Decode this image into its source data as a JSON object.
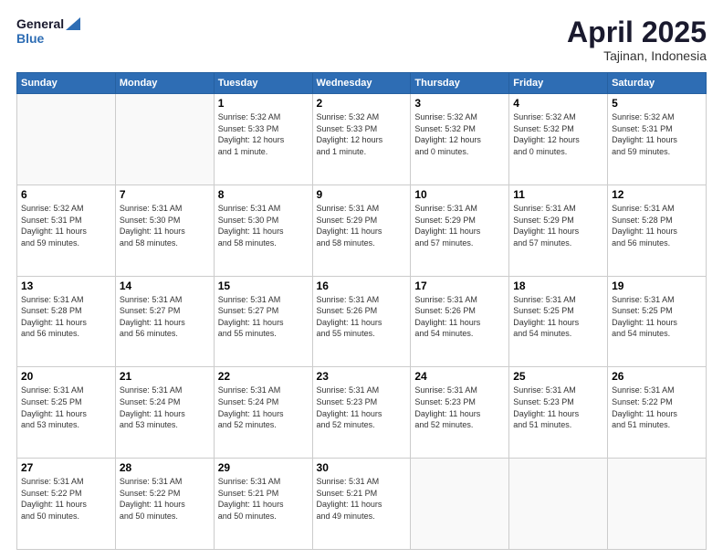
{
  "header": {
    "logo_line1": "General",
    "logo_line2": "Blue",
    "title": "April 2025",
    "location": "Tajinan, Indonesia"
  },
  "days_of_week": [
    "Sunday",
    "Monday",
    "Tuesday",
    "Wednesday",
    "Thursday",
    "Friday",
    "Saturday"
  ],
  "weeks": [
    [
      {
        "day": "",
        "info": ""
      },
      {
        "day": "",
        "info": ""
      },
      {
        "day": "1",
        "info": "Sunrise: 5:32 AM\nSunset: 5:33 PM\nDaylight: 12 hours\nand 1 minute."
      },
      {
        "day": "2",
        "info": "Sunrise: 5:32 AM\nSunset: 5:33 PM\nDaylight: 12 hours\nand 1 minute."
      },
      {
        "day": "3",
        "info": "Sunrise: 5:32 AM\nSunset: 5:32 PM\nDaylight: 12 hours\nand 0 minutes."
      },
      {
        "day": "4",
        "info": "Sunrise: 5:32 AM\nSunset: 5:32 PM\nDaylight: 12 hours\nand 0 minutes."
      },
      {
        "day": "5",
        "info": "Sunrise: 5:32 AM\nSunset: 5:31 PM\nDaylight: 11 hours\nand 59 minutes."
      }
    ],
    [
      {
        "day": "6",
        "info": "Sunrise: 5:32 AM\nSunset: 5:31 PM\nDaylight: 11 hours\nand 59 minutes."
      },
      {
        "day": "7",
        "info": "Sunrise: 5:31 AM\nSunset: 5:30 PM\nDaylight: 11 hours\nand 58 minutes."
      },
      {
        "day": "8",
        "info": "Sunrise: 5:31 AM\nSunset: 5:30 PM\nDaylight: 11 hours\nand 58 minutes."
      },
      {
        "day": "9",
        "info": "Sunrise: 5:31 AM\nSunset: 5:29 PM\nDaylight: 11 hours\nand 58 minutes."
      },
      {
        "day": "10",
        "info": "Sunrise: 5:31 AM\nSunset: 5:29 PM\nDaylight: 11 hours\nand 57 minutes."
      },
      {
        "day": "11",
        "info": "Sunrise: 5:31 AM\nSunset: 5:29 PM\nDaylight: 11 hours\nand 57 minutes."
      },
      {
        "day": "12",
        "info": "Sunrise: 5:31 AM\nSunset: 5:28 PM\nDaylight: 11 hours\nand 56 minutes."
      }
    ],
    [
      {
        "day": "13",
        "info": "Sunrise: 5:31 AM\nSunset: 5:28 PM\nDaylight: 11 hours\nand 56 minutes."
      },
      {
        "day": "14",
        "info": "Sunrise: 5:31 AM\nSunset: 5:27 PM\nDaylight: 11 hours\nand 56 minutes."
      },
      {
        "day": "15",
        "info": "Sunrise: 5:31 AM\nSunset: 5:27 PM\nDaylight: 11 hours\nand 55 minutes."
      },
      {
        "day": "16",
        "info": "Sunrise: 5:31 AM\nSunset: 5:26 PM\nDaylight: 11 hours\nand 55 minutes."
      },
      {
        "day": "17",
        "info": "Sunrise: 5:31 AM\nSunset: 5:26 PM\nDaylight: 11 hours\nand 54 minutes."
      },
      {
        "day": "18",
        "info": "Sunrise: 5:31 AM\nSunset: 5:25 PM\nDaylight: 11 hours\nand 54 minutes."
      },
      {
        "day": "19",
        "info": "Sunrise: 5:31 AM\nSunset: 5:25 PM\nDaylight: 11 hours\nand 54 minutes."
      }
    ],
    [
      {
        "day": "20",
        "info": "Sunrise: 5:31 AM\nSunset: 5:25 PM\nDaylight: 11 hours\nand 53 minutes."
      },
      {
        "day": "21",
        "info": "Sunrise: 5:31 AM\nSunset: 5:24 PM\nDaylight: 11 hours\nand 53 minutes."
      },
      {
        "day": "22",
        "info": "Sunrise: 5:31 AM\nSunset: 5:24 PM\nDaylight: 11 hours\nand 52 minutes."
      },
      {
        "day": "23",
        "info": "Sunrise: 5:31 AM\nSunset: 5:23 PM\nDaylight: 11 hours\nand 52 minutes."
      },
      {
        "day": "24",
        "info": "Sunrise: 5:31 AM\nSunset: 5:23 PM\nDaylight: 11 hours\nand 52 minutes."
      },
      {
        "day": "25",
        "info": "Sunrise: 5:31 AM\nSunset: 5:23 PM\nDaylight: 11 hours\nand 51 minutes."
      },
      {
        "day": "26",
        "info": "Sunrise: 5:31 AM\nSunset: 5:22 PM\nDaylight: 11 hours\nand 51 minutes."
      }
    ],
    [
      {
        "day": "27",
        "info": "Sunrise: 5:31 AM\nSunset: 5:22 PM\nDaylight: 11 hours\nand 50 minutes."
      },
      {
        "day": "28",
        "info": "Sunrise: 5:31 AM\nSunset: 5:22 PM\nDaylight: 11 hours\nand 50 minutes."
      },
      {
        "day": "29",
        "info": "Sunrise: 5:31 AM\nSunset: 5:21 PM\nDaylight: 11 hours\nand 50 minutes."
      },
      {
        "day": "30",
        "info": "Sunrise: 5:31 AM\nSunset: 5:21 PM\nDaylight: 11 hours\nand 49 minutes."
      },
      {
        "day": "",
        "info": ""
      },
      {
        "day": "",
        "info": ""
      },
      {
        "day": "",
        "info": ""
      }
    ]
  ]
}
